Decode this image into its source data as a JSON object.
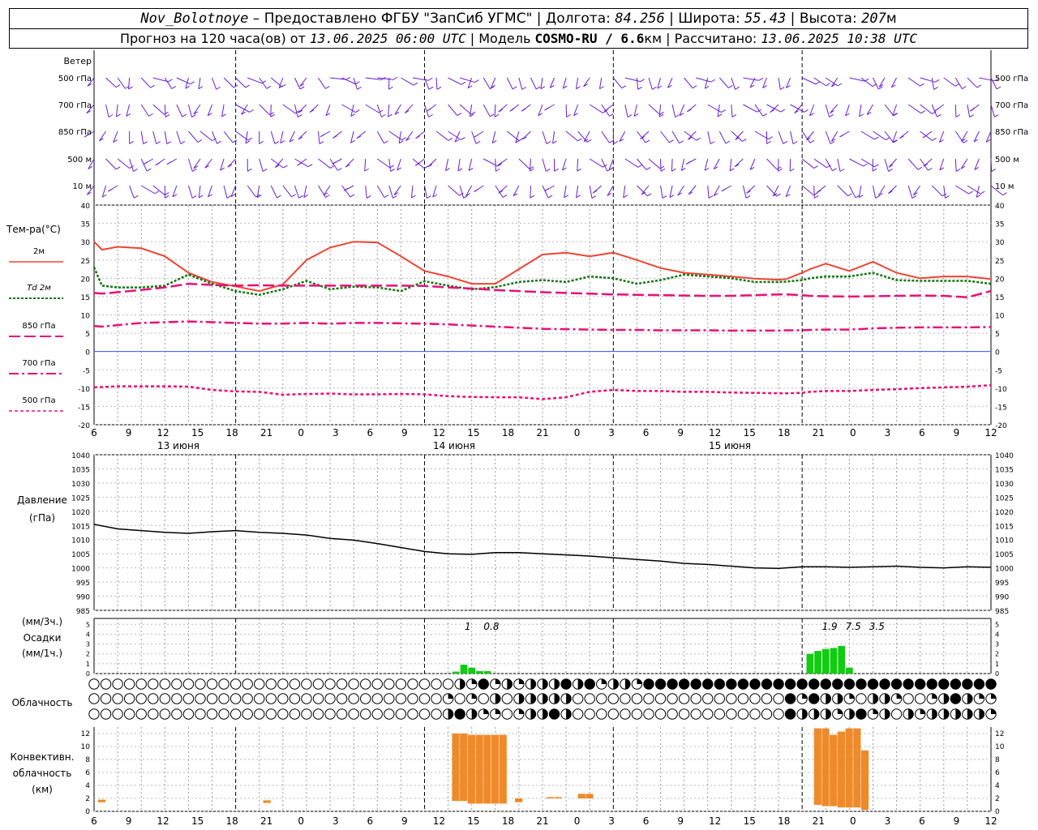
{
  "header": {
    "station": "Nov_Bolotnoye",
    "provider": " – Предоставлено ФГБУ \"ЗапСиб УГМС\" | Долгота: ",
    "lon": "84.256",
    "lat_label": " | Широта: ",
    "lat": "55.43",
    "alt_label": " | Высота: ",
    "alt": "207",
    "alt_unit": "м",
    "forecast_label": "Прогноз на 120 часа(ов) от ",
    "forecast_from": "13.06.2025 06:00 UTC",
    "model_label": "  | Модель ",
    "model": "COSMO-RU / 6.6",
    "model_unit": "км",
    "calc_label": " | Рассчитано: ",
    "calc_time": "13.06.2025 10:38 UTC"
  },
  "wind_panel": {
    "title": "Ветер",
    "levels": [
      "500 гПа",
      "700 гПа",
      "850 гПа",
      "500  м",
      "10  м"
    ]
  },
  "temp_panel": {
    "title": "Тем-ра(°C)",
    "legend": [
      "2м",
      "Td  2м",
      "850 гПа",
      "700 гПа",
      "500 гПа"
    ],
    "y_ticks": [
      "40",
      "35",
      "30",
      "25",
      "20",
      "15",
      "10",
      "5",
      "0",
      "-5",
      "-10",
      "-15",
      "-20"
    ]
  },
  "time_axis": {
    "hour_labels": [
      "6",
      "9",
      "12",
      "15",
      "18",
      "21",
      "0",
      "3",
      "6",
      "9",
      "12",
      "15",
      "18",
      "21",
      "0",
      "3",
      "6",
      "9",
      "12",
      "15",
      "18",
      "21",
      "0",
      "3",
      "6",
      "9",
      "12"
    ],
    "day_labels": [
      "13 июня",
      "14 июня",
      "15 июня"
    ]
  },
  "pressure_panel": {
    "title": "Давление",
    "unit": "(гПа)",
    "y_ticks": [
      "1040",
      "1035",
      "1030",
      "1025",
      "1020",
      "1015",
      "1010",
      "1005",
      "1000",
      "995",
      "990",
      "985"
    ]
  },
  "precip_panel": {
    "unit_3h": "(мм/3ч.)",
    "title": "Осадки",
    "unit_1h": "(мм/1ч.)",
    "y_ticks": [
      "5",
      "4",
      "3",
      "2",
      "1",
      "0"
    ],
    "totals": [
      {
        "hour": 47.5,
        "label": "1"
      },
      {
        "hour": 50.5,
        "label": "0.8"
      },
      {
        "hour": 93.5,
        "label": "1.9"
      },
      {
        "hour": 96.5,
        "label": "7.5"
      },
      {
        "hour": 99.5,
        "label": "3.5"
      }
    ]
  },
  "cloud_panel": {
    "title": "Облачность"
  },
  "conv_panel": {
    "title_1": "Конвективн.",
    "title_2": "облачность",
    "unit": "(км)",
    "y_ticks": [
      "12",
      "10",
      "8",
      "6",
      "4",
      "2",
      "0"
    ]
  },
  "colors": {
    "t2m": "#ee4433",
    "td2m": "#117711",
    "t850": "#e8107a",
    "t700": "#e8107a",
    "t500": "#e8107a",
    "wind": "#6a1ed0",
    "precip": "#11cc11",
    "conv": "#ef8a2a"
  },
  "chart_data": [
    {
      "type": "line",
      "title": "Тем-ра(°C)",
      "xlabel": "",
      "ylabel": "°C",
      "x_hours_from_start": [
        0,
        1,
        3,
        6,
        9,
        12,
        15,
        18,
        21,
        24,
        27,
        30,
        33,
        36,
        39,
        42,
        45,
        48,
        51,
        54,
        57,
        60,
        63,
        66,
        69,
        72,
        75,
        78,
        81,
        84,
        87,
        88,
        90,
        91,
        93,
        96,
        99,
        102,
        105,
        108,
        111,
        114
      ],
      "ylim": [
        -20,
        40
      ],
      "series": [
        {
          "name": "2м",
          "values": [
            30,
            27.8,
            28.6,
            28.2,
            26,
            21.5,
            19,
            17.8,
            16.5,
            18.3,
            25,
            28.4,
            30,
            29.8,
            26,
            22,
            20.5,
            18.5,
            18.5,
            22.5,
            26.5,
            27,
            26,
            27,
            25,
            22.8,
            21.5,
            21,
            20.5,
            19.9,
            19.6,
            19.8,
            21.5,
            22.5,
            24,
            22,
            24.5,
            21.5,
            20,
            20.5,
            20.5,
            19.8
          ]
        },
        {
          "name": "Td  2м",
          "values": [
            23,
            18,
            17.5,
            17.5,
            18,
            21,
            18.5,
            16.5,
            15.5,
            17,
            19.3,
            17,
            17.7,
            17.5,
            16.5,
            19.2,
            18,
            17,
            17.6,
            19,
            19.5,
            19,
            20.5,
            20,
            18.5,
            19.5,
            21,
            20.5,
            20,
            19,
            19,
            19.1,
            19.5,
            20,
            20.5,
            20.5,
            21.5,
            19.5,
            19.3,
            19.3,
            19.3,
            18.5
          ]
        },
        {
          "name": "850 гПа",
          "values": [
            16,
            15.8,
            16.2,
            16.8,
            17.5,
            18.5,
            18.2,
            18,
            18.1,
            18,
            18,
            18,
            18,
            18,
            18,
            17.9,
            17.5,
            17.2,
            16.8,
            16.5,
            16.2,
            16,
            15.8,
            15.6,
            15.5,
            15.4,
            15.3,
            15.2,
            15.2,
            15.4,
            15.6,
            15.6,
            15.4,
            15.2,
            15.1,
            15,
            15.1,
            15.2,
            15.3,
            15.2,
            14.8,
            16.5
          ]
        },
        {
          "name": "700 гПа",
          "values": [
            7,
            6.8,
            7.2,
            7.8,
            8,
            8.2,
            8,
            7.8,
            7.6,
            7.6,
            7.8,
            7.6,
            7.8,
            7.8,
            7.7,
            7.6,
            7.4,
            7.1,
            6.8,
            6.5,
            6.2,
            6.1,
            6.0,
            5.9,
            5.9,
            5.8,
            5.8,
            5.8,
            5.7,
            5.7,
            5.7,
            5.8,
            5.8,
            5.9,
            6.0,
            6.0,
            6.3,
            6.5,
            6.6,
            6.6,
            6.6,
            6.7
          ]
        },
        {
          "name": "500 гПа",
          "values": [
            -9.8,
            -9.7,
            -9.5,
            -9.5,
            -9.5,
            -9.6,
            -10.5,
            -10.9,
            -11,
            -11.8,
            -11.6,
            -11.5,
            -11.7,
            -11.7,
            -11.6,
            -11.7,
            -12.2,
            -12.4,
            -12.5,
            -12.5,
            -13.0,
            -12.5,
            -11,
            -10.5,
            -10.8,
            -10.8,
            -11,
            -11,
            -11.2,
            -11.3,
            -11.4,
            -11.4,
            -11.3,
            -11,
            -10.8,
            -10.8,
            -10.5,
            -10.3,
            -10,
            -9.8,
            -9.6,
            -9.2
          ]
        }
      ]
    },
    {
      "type": "line",
      "title": "Давление",
      "xlabel": "",
      "ylabel": "гПа",
      "x_hours_from_start": [
        0,
        3,
        6,
        9,
        12,
        15,
        18,
        21,
        24,
        27,
        30,
        33,
        36,
        39,
        42,
        45,
        48,
        51,
        54,
        57,
        60,
        63,
        66,
        69,
        72,
        75,
        78,
        81,
        84,
        87,
        90,
        93,
        96,
        99,
        102,
        105,
        108,
        111,
        114
      ],
      "ylim": [
        985,
        1040
      ],
      "series": [
        {
          "name": "Давление",
          "values": [
            1015.4,
            1013.8,
            1013.2,
            1012.6,
            1012.2,
            1012.8,
            1013.2,
            1012.6,
            1012.2,
            1011.6,
            1010.4,
            1009.8,
            1008.6,
            1007.2,
            1005.8,
            1005.0,
            1004.8,
            1005.4,
            1005.4,
            1005.0,
            1004.6,
            1004.2,
            1003.6,
            1003.0,
            1002.4,
            1001.6,
            1001.2,
            1000.6,
            1000.0,
            999.8,
            1000.4,
            1000.4,
            1000.2,
            1000.4,
            1000.6,
            1000.2,
            1000.0,
            1000.4,
            1000.2
          ]
        }
      ]
    },
    {
      "type": "bar",
      "title": "Осадки",
      "xlabel": "",
      "ylabel": "мм/1ч.",
      "ylim": [
        0,
        5
      ],
      "x_hours_from_start": [
        46,
        47,
        48,
        49,
        50,
        91,
        92,
        93,
        94,
        95,
        96
      ],
      "values": [
        0.2,
        0.9,
        0.6,
        0.25,
        0.25,
        2.0,
        2.3,
        2.5,
        2.6,
        2.8,
        0.6
      ]
    },
    {
      "type": "bar",
      "title": "Конвективн. облачность",
      "xlabel": "",
      "ylabel": "км",
      "ylim": [
        0,
        13
      ],
      "x_hours_from_start": [
        1,
        22,
        46,
        47,
        48,
        49,
        50,
        51,
        52,
        54,
        58,
        59,
        62,
        63,
        92,
        93,
        94,
        95,
        96,
        97,
        98
      ],
      "bottom": [
        1.4,
        1.3,
        1.6,
        1.6,
        1.2,
        1.2,
        1.2,
        1.2,
        1.2,
        1.4,
        2.0,
        2.0,
        2.0,
        2.0,
        1.0,
        0.8,
        0.8,
        0.6,
        0.6,
        0.6,
        0.2
      ],
      "top": [
        1.8,
        1.7,
        12.0,
        12.0,
        11.8,
        11.8,
        11.8,
        11.8,
        11.8,
        2.0,
        2.2,
        2.2,
        2.7,
        2.7,
        12.8,
        12.8,
        11.8,
        12.3,
        12.8,
        12.8,
        9.4
      ]
    }
  ]
}
